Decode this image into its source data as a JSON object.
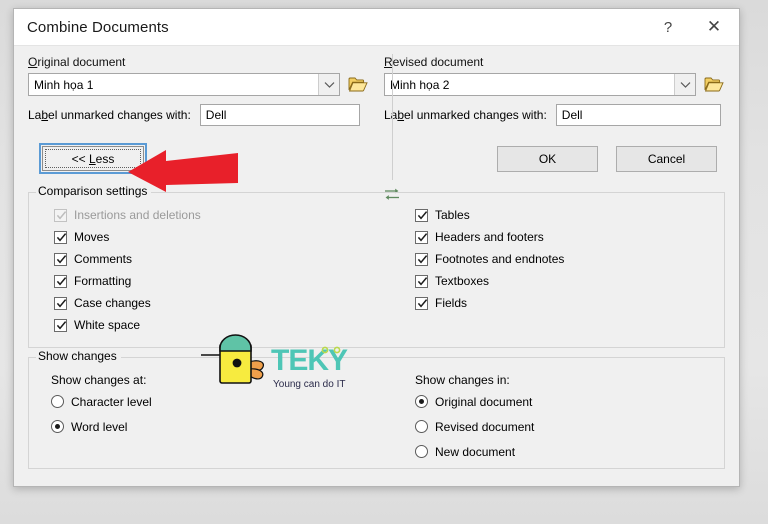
{
  "dialog": {
    "title": "Combine Documents",
    "help_label": "?",
    "close_label": "✕"
  },
  "original": {
    "group_label": "Original document",
    "group_label_accel": "O",
    "combo_value": "Minh họa 1",
    "folder_icon": "open-folder-icon",
    "dropdown_icon": "chevron-down-icon",
    "unmarked_label": "Label unmarked changes with:",
    "unmarked_value": "Dell"
  },
  "revised": {
    "group_label": "Revised document",
    "group_label_accel": "R",
    "combo_value": "Minh họa 2",
    "folder_icon": "open-folder-icon",
    "dropdown_icon": "chevron-down-icon",
    "unmarked_label": "Label unmarked changes with:",
    "unmarked_value": "Dell"
  },
  "swap": {
    "icon": "swap-documents-icon",
    "color": "#5f8a5f"
  },
  "actions": {
    "less_label": "<< Less",
    "ok_label": "OK",
    "cancel_label": "Cancel",
    "focus_color": "#5b9bd5"
  },
  "comparison_settings": {
    "group_title": "Comparison settings",
    "left_column": [
      {
        "label": "Insertions and deletions",
        "checked": true,
        "disabled": true
      },
      {
        "label": "Moves",
        "checked": true,
        "disabled": false
      },
      {
        "label": "Comments",
        "checked": true,
        "disabled": false
      },
      {
        "label": "Formatting",
        "checked": true,
        "disabled": false
      },
      {
        "label": "Case changes",
        "checked": true,
        "disabled": false
      },
      {
        "label": "White space",
        "checked": true,
        "disabled": false
      }
    ],
    "right_column": [
      {
        "label": "Tables",
        "checked": true,
        "disabled": false
      },
      {
        "label": "Headers and footers",
        "checked": true,
        "disabled": false
      },
      {
        "label": "Footnotes and endnotes",
        "checked": true,
        "disabled": false
      },
      {
        "label": "Textboxes",
        "checked": true,
        "disabled": false
      },
      {
        "label": "Fields",
        "checked": true,
        "disabled": false
      }
    ]
  },
  "show_changes": {
    "group_title": "Show changes",
    "at_label": "Show changes at:",
    "at_options": [
      {
        "label": "Character level",
        "selected": false
      },
      {
        "label": "Word level",
        "selected": true
      }
    ],
    "in_label": "Show changes in:",
    "in_options": [
      {
        "label": "Original document",
        "selected": true
      },
      {
        "label": "Revised document",
        "selected": false
      },
      {
        "label": "New document",
        "selected": false
      }
    ]
  },
  "watermark": {
    "name": "teky-logo",
    "brand_text": "TEKY",
    "tagline": "Young can do IT",
    "brand_color": "#4ec6b6",
    "chick_body_color": "#f7eb3f",
    "chick_cap_color": "#5fc3a6"
  },
  "annotation": {
    "name": "red-arrow-pointing-to-less-button",
    "color": "#e8202a",
    "direction": "left"
  }
}
